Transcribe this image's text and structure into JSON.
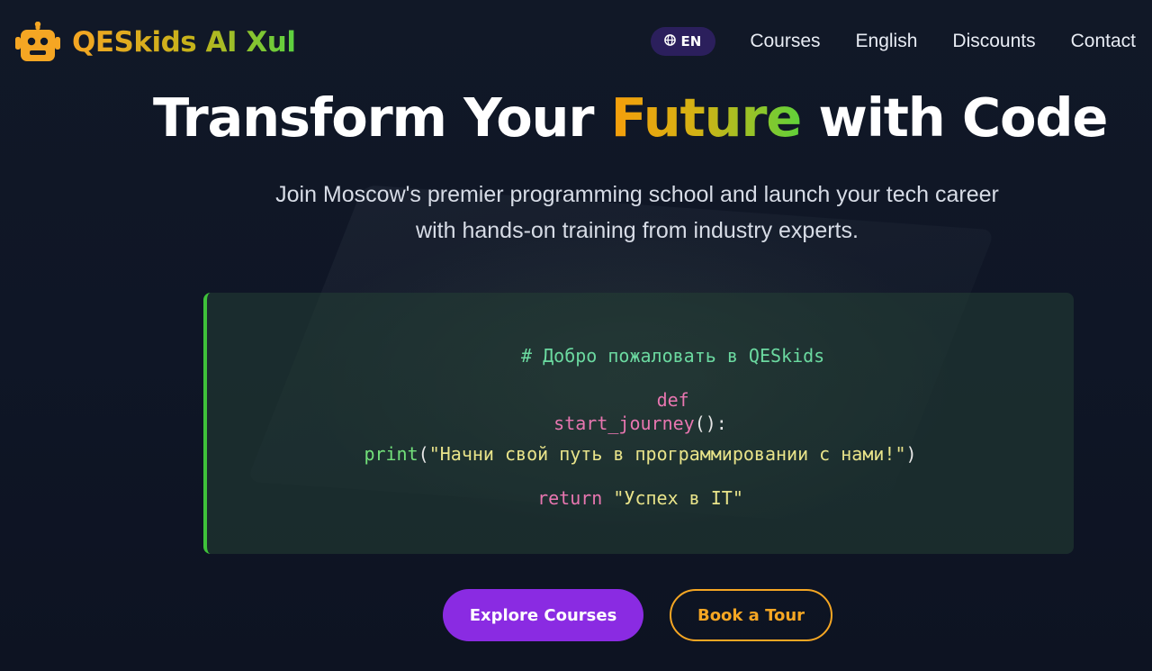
{
  "header": {
    "logo_text": "QESkids AI Xul",
    "language": "EN",
    "nav": [
      "Courses",
      "English",
      "Discounts",
      "Contact"
    ]
  },
  "hero": {
    "title_before": "Transform Your ",
    "title_highlight": "Future",
    "title_after": " with Code",
    "subtitle_line1": "Join Moscow's premier programming school and launch your tech career",
    "subtitle_line2": "with hands-on training from industry experts."
  },
  "code": {
    "comment": "# Добро пожаловать в QESkids",
    "def_keyword": "def",
    "function_name": "start_journey",
    "function_suffix": "():",
    "print_keyword": "print",
    "print_open": "(",
    "print_string": "\"Начни свой путь в программировании с нами!\"",
    "print_close": ")",
    "return_keyword": "return",
    "return_string": "\"Успех в IT\""
  },
  "buttons": {
    "primary": "Explore Courses",
    "secondary": "Book a Tour"
  },
  "colors": {
    "accent_purple": "#8a2be2",
    "accent_orange": "#f5a623",
    "accent_green": "#3fc23a",
    "background": "#0f1525"
  },
  "icons": {
    "logo": "robot-icon",
    "language": "globe-icon"
  }
}
